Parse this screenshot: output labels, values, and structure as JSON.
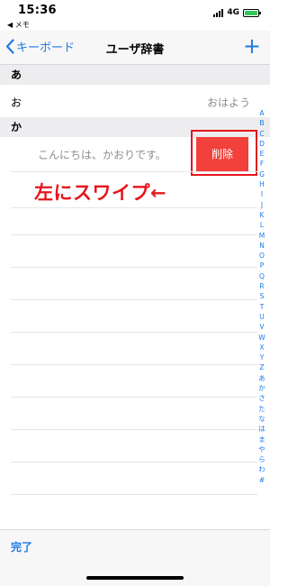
{
  "status_bar": {
    "time": "15:36",
    "back_app": "◀ メモ",
    "network": "4G",
    "battery_level": 1.0
  },
  "nav": {
    "back_label": "キーボード",
    "title": "ユーザ辞書",
    "add_label": "+"
  },
  "sections": [
    {
      "header": "あ",
      "entries": [
        {
          "reading": "お",
          "word": "おはよう"
        }
      ]
    },
    {
      "header": "か",
      "entries": [
        {
          "text": "こんにちは、かおりです。",
          "action": "削除"
        }
      ]
    }
  ],
  "annotation": "左にスワイプ←",
  "index": [
    "A",
    "B",
    "C",
    "D",
    "E",
    "F",
    "G",
    "H",
    "I",
    "J",
    "K",
    "L",
    "M",
    "N",
    "O",
    "P",
    "Q",
    "R",
    "S",
    "T",
    "U",
    "V",
    "W",
    "X",
    "Y",
    "Z",
    "あ",
    "か",
    "さ",
    "た",
    "な",
    "は",
    "ま",
    "や",
    "ら",
    "わ",
    "#"
  ],
  "toolbar": {
    "done_label": "完了"
  },
  "colors": {
    "accent": "#1f7ae5",
    "delete": "#f2403a",
    "annotation": "#e4161b",
    "battery": "#34c759"
  }
}
